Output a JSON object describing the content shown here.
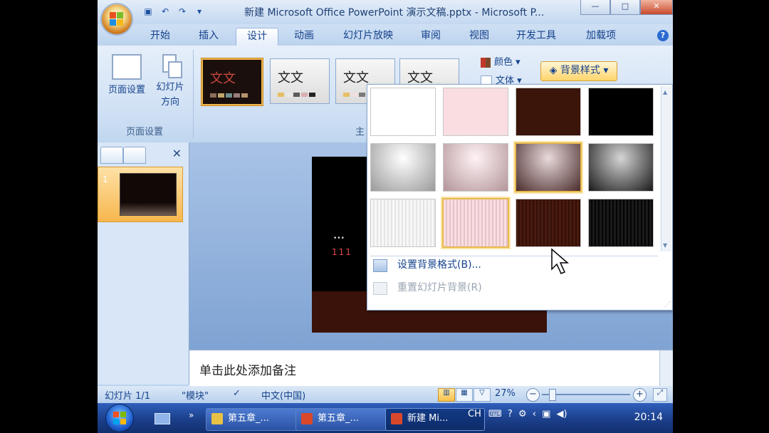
{
  "window": {
    "title": "新建 Microsoft Office PowerPoint 演示文稿.pptx - Microsoft P...",
    "controls": {
      "minimize": "—",
      "maximize": "□",
      "close": "✕"
    }
  },
  "quick_access": [
    "save-icon",
    "undo-icon",
    "redo-icon"
  ],
  "tabs": [
    {
      "label": "开始"
    },
    {
      "label": "插入"
    },
    {
      "label": "设计"
    },
    {
      "label": "动画"
    },
    {
      "label": "幻灯片放映"
    },
    {
      "label": "审阅"
    },
    {
      "label": "视图"
    },
    {
      "label": "开发工具"
    },
    {
      "label": "加载项"
    }
  ],
  "ribbon": {
    "page_setup": {
      "label": "页面设置",
      "orientation_label": "幻灯片",
      "orientation_label2": "方向",
      "group_label": "页面设置"
    },
    "themes": {
      "group_label_partial": "主",
      "theme_text": "文文"
    },
    "colors_label": "颜色",
    "fonts_label": "文体",
    "background_styles_label": "背景样式"
  },
  "background_gallery": {
    "rows": [
      [
        "#ffffff",
        "#f9dde1",
        "#3b140a",
        "#000000"
      ],
      [
        "gradient-gray",
        "gradient-pink",
        "gradient-brown",
        "gradient-black"
      ],
      [
        "texture-white",
        "texture-pink",
        "texture-brown",
        "texture-black"
      ]
    ],
    "selected": "1,2",
    "hovered": "2,1",
    "menu": [
      {
        "label": "设置背景格式(B)...",
        "enabled": true
      },
      {
        "label": "重置幻灯片背景(R)",
        "enabled": false
      }
    ]
  },
  "slide_panel": {
    "slide_number": "1"
  },
  "slide": {
    "line1": "•••",
    "line2": "111"
  },
  "notes": {
    "placeholder": "单击此处添加备注"
  },
  "status": {
    "slide_info": "幻灯片 1/1",
    "theme_name": "\"模块\"",
    "language": "中文(中国)",
    "zoom": "27%"
  },
  "taskbar": {
    "items": [
      {
        "label": "第五章_..."
      },
      {
        "label": "第五章_..."
      },
      {
        "label": "新建 Mi..."
      }
    ],
    "lang": "CH",
    "clock": "20:14"
  },
  "colors": {
    "accent_orange": "#f7c14b",
    "office_blue": "#15428b"
  }
}
